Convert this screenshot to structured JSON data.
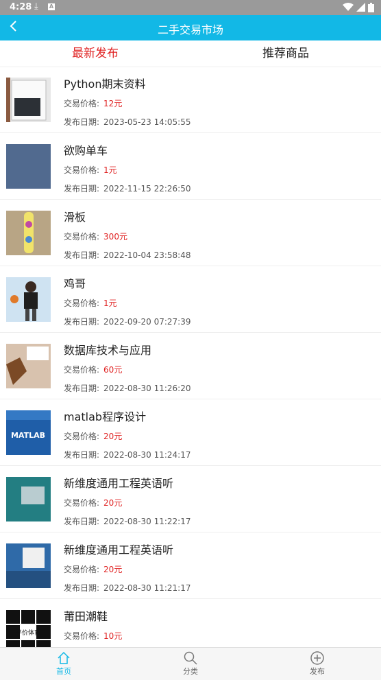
{
  "status": {
    "time": "4:28"
  },
  "header": {
    "title": "二手交易市场"
  },
  "tabs": {
    "latest": "最新发布",
    "recommended": "推荐商品"
  },
  "labels": {
    "price": "交易价格:",
    "date": "发布日期:"
  },
  "items": [
    {
      "title": "Python期末资料",
      "price": "12元",
      "date": "2023-05-23 14:05:55",
      "thumb": "doc"
    },
    {
      "title": "欲购单车",
      "price": "1元",
      "date": "2022-11-15 22:26:50",
      "thumb": "denim"
    },
    {
      "title": "滑板",
      "price": "300元",
      "date": "2022-10-04 23:58:48",
      "thumb": "skate"
    },
    {
      "title": "鸡哥",
      "price": "1元",
      "date": "2022-09-20 07:27:39",
      "thumb": "person"
    },
    {
      "title": "数据库技术与应用",
      "price": "60元",
      "date": "2022-08-30 11:26:20",
      "thumb": "book-white"
    },
    {
      "title": "matlab程序设计",
      "price": "20元",
      "date": "2022-08-30 11:24:17",
      "thumb": "matlab"
    },
    {
      "title": "新维度通用工程英语听",
      "price": "20元",
      "date": "2022-08-30 11:22:17",
      "thumb": "teal-book"
    },
    {
      "title": "新维度通用工程英语听",
      "price": "20元",
      "date": "2022-08-30 11:21:17",
      "thumb": "blue-book"
    },
    {
      "title": "莆田潮鞋",
      "price": "10元",
      "date": "",
      "thumb": "logos"
    }
  ],
  "thumb_logo_text": "平价体育",
  "thumb_matlab_text": "MATLAB",
  "nav": {
    "home": "首页",
    "category": "分类",
    "publish": "发布"
  },
  "colors": {
    "accent": "#12b8e6",
    "price": "#e02424"
  }
}
